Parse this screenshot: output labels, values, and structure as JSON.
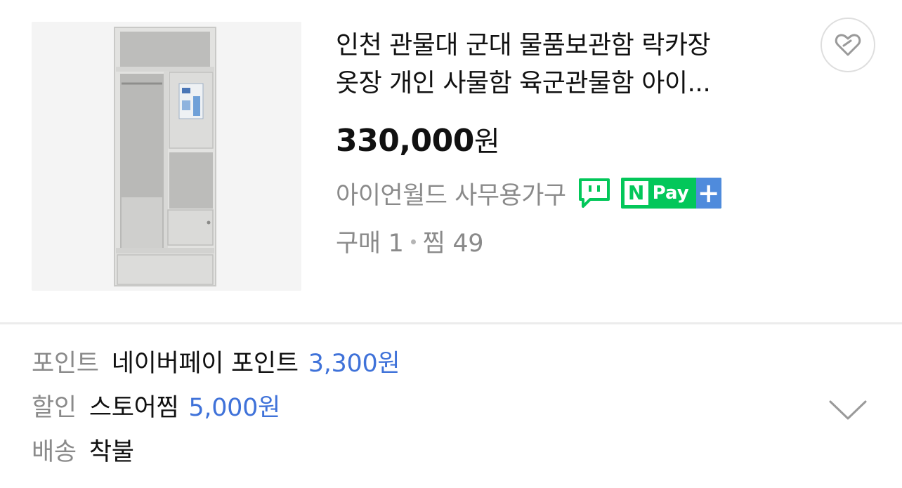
{
  "product": {
    "title_line1": "인천 관물대 군대 물품보관함 락카장",
    "title_line2": "옷장 개인 사물함 육군관물함 아이...",
    "price_value": "330,000",
    "price_unit": "원",
    "store_name": "아이언월드 사무용가구",
    "talk_icon": "talk-chat-icon",
    "npay_n": "N",
    "npay_label": "Pay",
    "npay_plus": "+",
    "purchases": "구매 1",
    "likes": "찜 49",
    "favorite_icon": "heart-icon"
  },
  "benefits": {
    "point_label": "포인트",
    "point_value": "네이버페이 포인트",
    "point_amount": "3,300원",
    "discount_label": "할인",
    "discount_value": "스토어찜",
    "discount_amount": "5,000원",
    "shipping_label": "배송",
    "shipping_value": "착불",
    "expand_icon": "chevron-down-icon"
  },
  "colors": {
    "npay_green": "#03c75a",
    "npay_plus_blue": "#4f8bdc",
    "amount_blue": "#3f72d9",
    "muted_gray": "#8a8a8a"
  }
}
